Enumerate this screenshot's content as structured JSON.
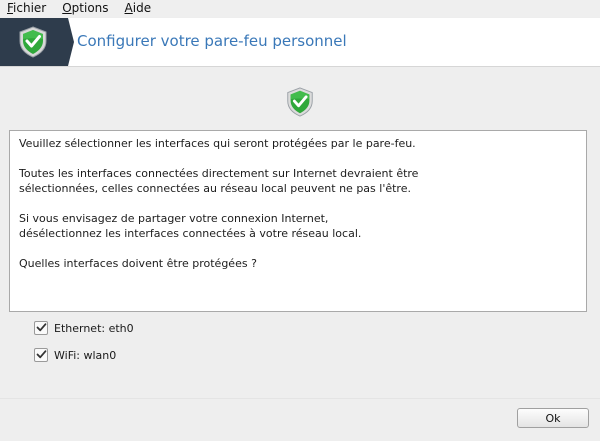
{
  "menubar": {
    "items": [
      {
        "label_first": "F",
        "label_rest": "ichier"
      },
      {
        "label_first": "O",
        "label_rest": "ptions"
      },
      {
        "label_first": "A",
        "label_rest": "ide"
      }
    ]
  },
  "banner": {
    "title": "Configurer votre pare-feu personnel",
    "icon": "shield-check-icon"
  },
  "info": {
    "paragraphs": [
      "Veuillez sélectionner les interfaces qui seront protégées par le pare-feu.",
      "Toutes les interfaces connectées directement sur Internet devraient être\nsélectionnées, celles connectées au réseau local peuvent ne pas l'être.",
      "Si vous envisagez de partager votre connexion Internet,\ndésélectionnez les interfaces connectées à votre réseau local.",
      "Quelles interfaces doivent être protégées ?"
    ]
  },
  "interfaces": [
    {
      "label": "Ethernet: eth0",
      "checked": true
    },
    {
      "label": "WiFi: wlan0",
      "checked": true
    }
  ],
  "buttons": {
    "ok_label": "Ok"
  },
  "colors": {
    "banner_dark": "#2e3c4c",
    "title_blue": "#3a78b8",
    "shield_green": "#2fa83a"
  }
}
